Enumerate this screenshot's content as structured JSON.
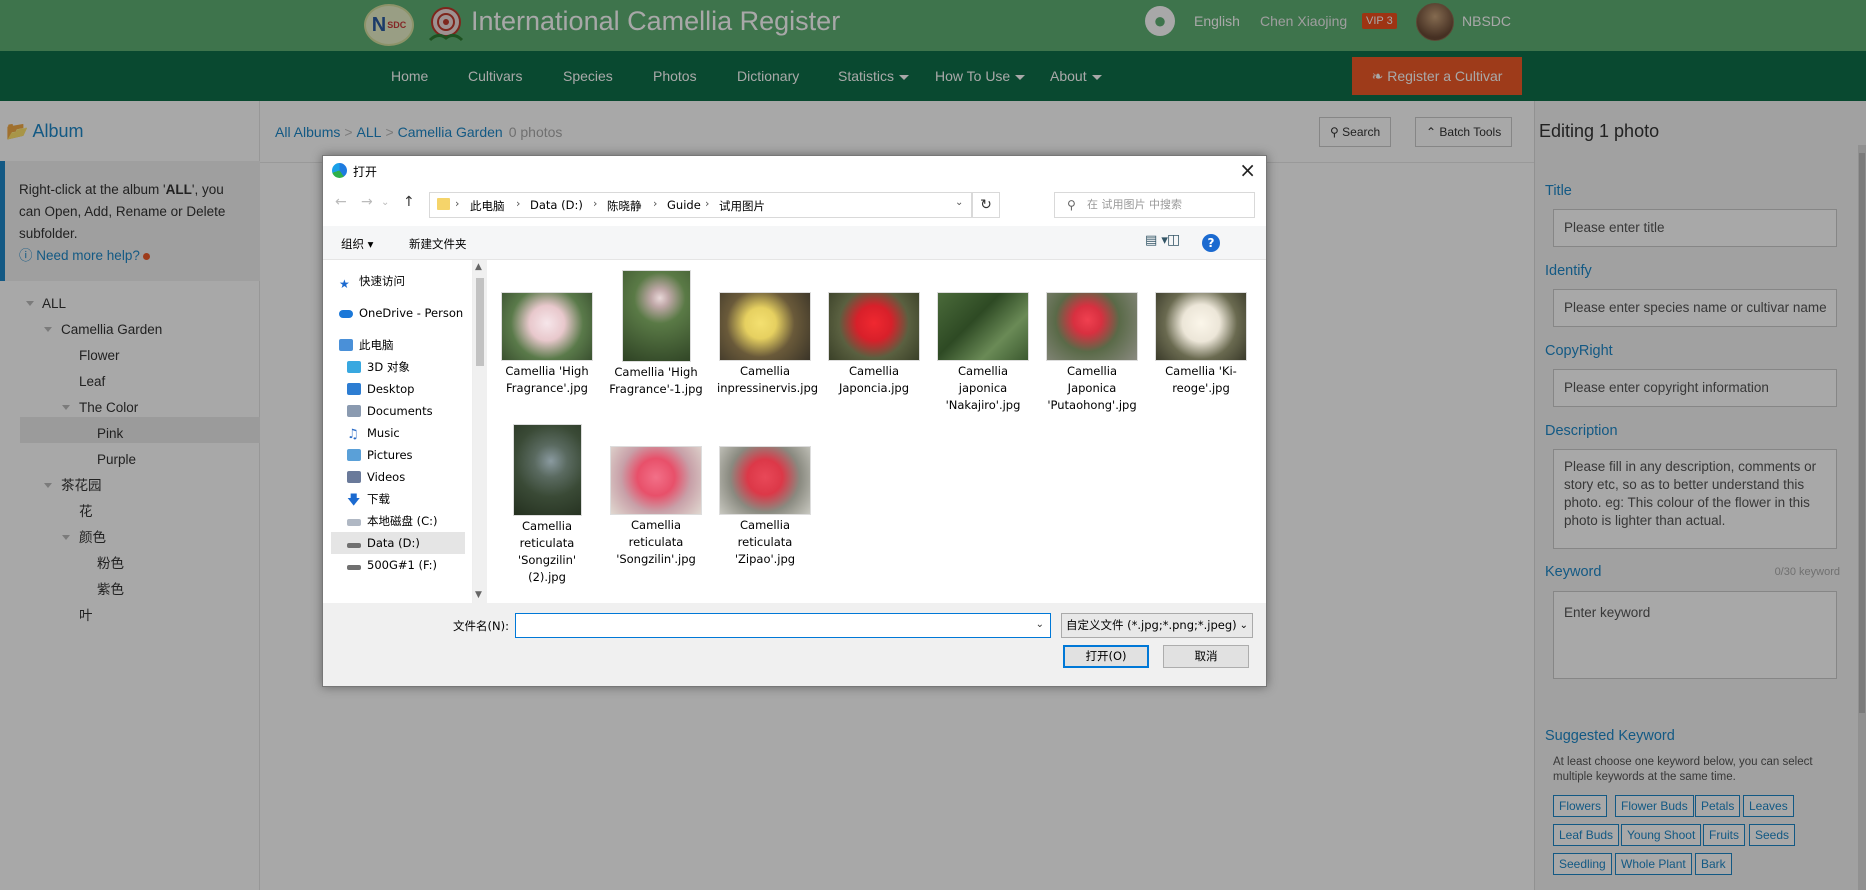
{
  "header": {
    "logo_text": "NSDC",
    "site_title": "International Camellia Register",
    "language": "English",
    "user_name": "Chen Xiaojing",
    "vip_badge": "VIP 3",
    "org": "NBSDC",
    "icons": {
      "globe": "globe-icon",
      "avatar": "avatar"
    }
  },
  "nav": {
    "items": [
      "Home",
      "Cultivars",
      "Species",
      "Photos",
      "Dictionary",
      "Statistics",
      "How To Use",
      "About"
    ],
    "register_button": "Register a Cultivar",
    "colors": {
      "topbar": "#5fb074",
      "navbar": "#0f7049",
      "register": "#f05a28"
    }
  },
  "sidebar": {
    "title": "Album",
    "hint_prefix": "Right-click at the album '",
    "hint_bold": "ALL",
    "hint_suffix": "', you can Open, Add, Rename or Delete subfolder.",
    "help_link": "Need more help?",
    "tree": [
      "ALL",
      "Camellia Garden",
      "Flower",
      "Leaf",
      "The Color",
      "Pink",
      "Purple",
      "茶花园",
      "花",
      "颜色",
      "粉色",
      "紫色",
      "叶"
    ]
  },
  "breadcrumb": {
    "items": [
      "All Albums",
      "ALL",
      "Camellia Garden"
    ],
    "count": "0 photos"
  },
  "toolbar": {
    "search": "Search",
    "batch_tools": "Batch Tools"
  },
  "right_panel": {
    "title": "Editing 1 photo",
    "title_label": "Title",
    "title_placeholder": "Please enter title",
    "identify_label": "Identify",
    "identify_placeholder": "Please enter species name or cultivar name",
    "copyright_label": "CopyRight",
    "copyright_placeholder": "Please enter copyright information",
    "description_label": "Description",
    "description_placeholder": "Please fill in any description, comments or story etc, so as to better understand this photo. eg: This colour of the flower in this photo is lighter than actual.",
    "keyword_label": "Keyword",
    "keyword_count": "0/30 keyword",
    "keyword_placeholder": "Enter keyword",
    "suggested_label": "Suggested Keyword",
    "suggested_hint": "At least choose one keyword below, you can select multiple keywords at the same time.",
    "tags": [
      "Flowers",
      "Flower Buds",
      "Petals",
      "Leaves",
      "Leaf Buds",
      "Young Shoot",
      "Fruits",
      "Seeds",
      "Seedling",
      "Whole Plant",
      "Bark"
    ]
  },
  "dialog": {
    "title": "打开",
    "path": [
      "此电脑",
      "Data (D:)",
      "陈晓静",
      "Guide",
      "试用图片"
    ],
    "search_placeholder": "在 试用图片 中搜索",
    "organize": "组织",
    "new_folder": "新建文件夹",
    "nav_pane": [
      "快速访问",
      "OneDrive - Person",
      "此电脑",
      "3D 对象",
      "Desktop",
      "Documents",
      "Music",
      "Pictures",
      "Videos",
      "下载",
      "本地磁盘 (C:)",
      "Data (D:)",
      "500G#1 (F:)"
    ],
    "files": [
      {
        "name": "Camellia 'High Fragrance'.jpg",
        "color": "#e8c8cc"
      },
      {
        "name": "Camellia 'High Fragrance'-1.jpg",
        "color": "#4a6a3a"
      },
      {
        "name": "Camellia inpressinervis.jpg",
        "color": "#e6d060"
      },
      {
        "name": "Camellia Japoncia.jpg",
        "color": "#d8202a"
      },
      {
        "name": "Camellia japonica 'Nakajiro'.jpg",
        "color": "#3c5a30"
      },
      {
        "name": "Camellia Japonica 'Putaohong'.jpg",
        "color": "#d83040"
      },
      {
        "name": "Camellia 'Ki-reoge'.jpg",
        "color": "#ece6d8"
      },
      {
        "name": "Camellia reticulata 'Songzilin' (2).jpg",
        "color": "#3a4a36"
      },
      {
        "name": "Camellia reticulata 'Songzilin'.jpg",
        "color": "#e8506a"
      },
      {
        "name": "Camellia reticulata 'Zipao'.jpg",
        "color": "#dc3848"
      }
    ],
    "filename_label": "文件名(N):",
    "filename_value": "",
    "filetype": "自定义文件 (*.jpg;*.png;*.jpeg)",
    "open_button": "打开(O)",
    "cancel_button": "取消"
  }
}
